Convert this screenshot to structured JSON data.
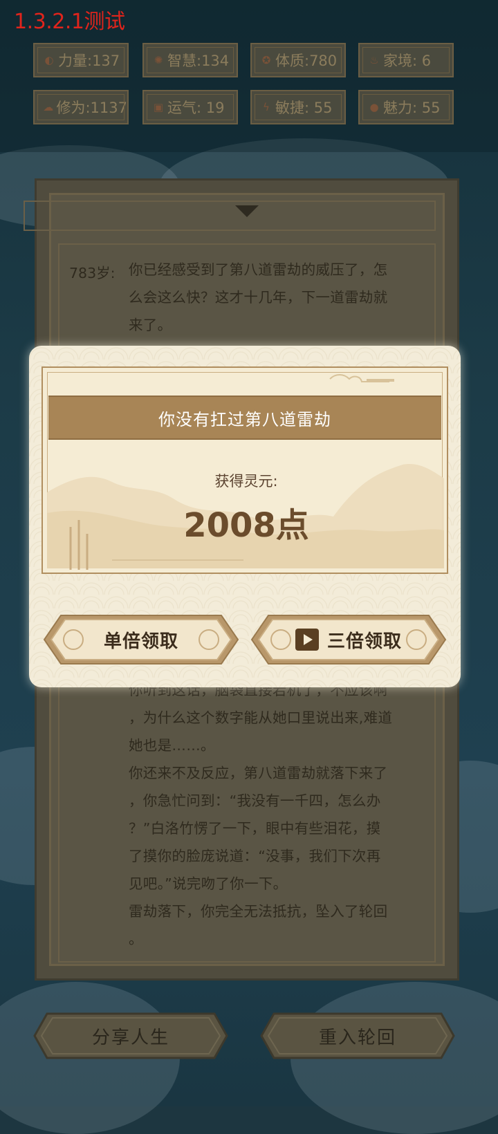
{
  "version_label": "1.3.2.1测试",
  "stats": [
    {
      "icon": "strength-icon",
      "label": "力量:137"
    },
    {
      "icon": "wisdom-icon",
      "label": "智慧:134"
    },
    {
      "icon": "constitution-icon",
      "label": "体质:780"
    },
    {
      "icon": "family-icon",
      "label": "家境:  6"
    },
    {
      "icon": "cultivation-icon",
      "label": "修为:1137"
    },
    {
      "icon": "luck-icon",
      "label": "运气:  19"
    },
    {
      "icon": "agility-icon",
      "label": "敏捷:  55"
    },
    {
      "icon": "charm-icon",
      "label": "魅力:  55"
    }
  ],
  "story": {
    "age": "783岁:",
    "top_lines": [
      "你已经感受到了第八道雷劫的威压了，怎",
      "么会这么快？这才十几年，下一道雷劫就",
      "来了。"
    ],
    "bottom_lines": [
      "你听到这话，脑袋直接宕机了，不应该啊",
      "，为什么这个数字能从她口里说出来,难道",
      "她也是……。",
      "你还来不及反应，第八道雷劫就落下来了",
      "，你急忙问到：“我没有一千四，怎么办",
      "？”白洛竹愣了一下，眼中有些泪花，摸",
      "了摸你的脸庞说道：“没事，我们下次再",
      "见吧。”说完吻了你一下。",
      "雷劫落下，你完全无法抵抗，坠入了轮回",
      "。"
    ]
  },
  "bottom_buttons": {
    "share": "分享人生",
    "reincarnate": "重入轮回"
  },
  "modal": {
    "title": "你没有扛过第八道雷劫",
    "reward_label": "获得灵元:",
    "reward_value": "2008点",
    "single_button": "单倍领取",
    "triple_button": "三倍领取"
  },
  "colors": {
    "version_red": "#e0241c",
    "band_brown": "#a88556",
    "modal_bg": "#f3ecd9"
  }
}
